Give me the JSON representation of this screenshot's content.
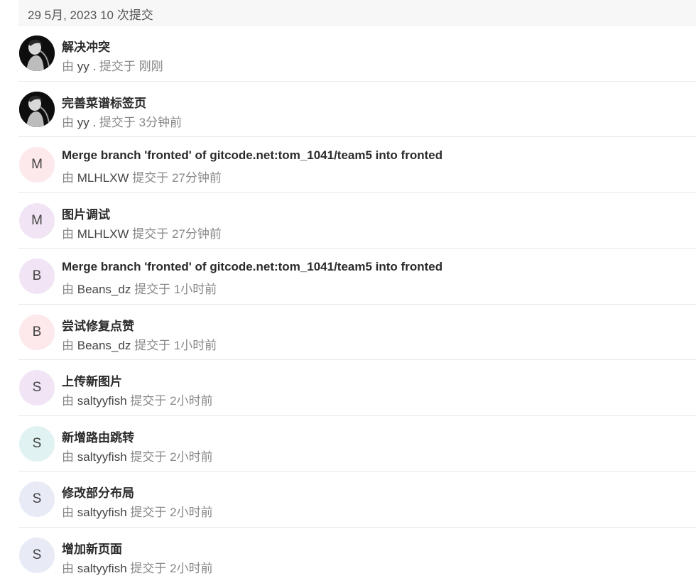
{
  "header": {
    "date_summary": "29 5月, 2023 10 次提交"
  },
  "labels": {
    "by": "由",
    "committed": "提交于"
  },
  "commits": [
    {
      "title": "解决冲突",
      "author": "yy .",
      "time": "刚刚",
      "avatar_type": "photo",
      "avatar_letter": "",
      "avatar_color": "#111111"
    },
    {
      "title": "完善菜谱标签页",
      "author": "yy .",
      "time": "3分钟前",
      "avatar_type": "photo",
      "avatar_letter": "",
      "avatar_color": "#111111"
    },
    {
      "title": "Merge branch 'fronted' of gitcode.net:tom_1041/team5 into fronted",
      "author": "MLHLXW",
      "time": "27分钟前",
      "avatar_type": "letter",
      "avatar_letter": "M",
      "avatar_color": "#fde8ec"
    },
    {
      "title": "图片调试",
      "author": "MLHLXW",
      "time": "27分钟前",
      "avatar_type": "letter",
      "avatar_letter": "M",
      "avatar_color": "#f1e4f5"
    },
    {
      "title": "Merge branch 'fronted' of gitcode.net:tom_1041/team5 into fronted",
      "author": "Beans_dz",
      "time": "1小时前",
      "avatar_type": "letter",
      "avatar_letter": "B",
      "avatar_color": "#f1e4f5"
    },
    {
      "title": "尝试修复点赞",
      "author": "Beans_dz",
      "time": "1小时前",
      "avatar_type": "letter",
      "avatar_letter": "B",
      "avatar_color": "#fde8ec"
    },
    {
      "title": "上传新图片",
      "author": "saltyyfish",
      "time": "2小时前",
      "avatar_type": "letter",
      "avatar_letter": "S",
      "avatar_color": "#f1e4f5"
    },
    {
      "title": "新增路由跳转",
      "author": "saltyyfish",
      "time": "2小时前",
      "avatar_type": "letter",
      "avatar_letter": "S",
      "avatar_color": "#e0f2f1"
    },
    {
      "title": "修改部分布局",
      "author": "saltyyfish",
      "time": "2小时前",
      "avatar_type": "letter",
      "avatar_letter": "S",
      "avatar_color": "#e8eaf6"
    },
    {
      "title": "增加新页面",
      "author": "saltyyfish",
      "time": "2小时前",
      "avatar_type": "letter",
      "avatar_letter": "S",
      "avatar_color": "#e8eaf6"
    }
  ]
}
